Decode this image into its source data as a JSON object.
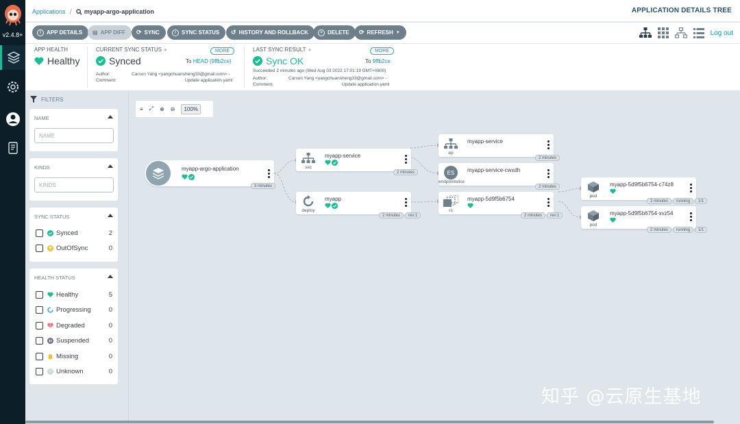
{
  "nav": {
    "version": "v2.4.8+",
    "items": [
      "applications-icon",
      "settings-icon",
      "user-icon",
      "docs-icon"
    ]
  },
  "header": {
    "breadcrumb_root": "Applications",
    "breadcrumb_current": "myapp-argo-application",
    "page_title": "APPLICATION DETAILS TREE"
  },
  "toolbar": {
    "buttons": [
      "APP DETAILS",
      "APP DIFF",
      "SYNC",
      "SYNC STATUS",
      "HISTORY AND ROLLBACK",
      "DELETE",
      "REFRESH"
    ],
    "logout": "Log out"
  },
  "status": {
    "app_health_label": "APP HEALTH",
    "app_health": "Healthy",
    "current_sync_label": "CURRENT SYNC STATUS",
    "current_sync": "Synced",
    "more": "MORE",
    "to_prefix": "To",
    "current_target": "HEAD (9ffb2ce)",
    "author_label": "Author:",
    "comment_label": "Comment:",
    "author": "Carson Yang <yangchuansheng33@gmail.com> -",
    "comment": "Update application.yaml",
    "last_sync_label": "LAST SYNC RESULT",
    "last_sync": "Sync OK",
    "last_target": "9ffb2ce",
    "succeeded": "Succeeded 2 minutes ago (Wed Aug 03 2022 17:01:19 GMT+0800)"
  },
  "filters": {
    "heading": "FILTERS",
    "name_title": "NAME",
    "name_placeholder": "NAME",
    "kinds_title": "KINDS",
    "kinds_placeholder": "KINDS",
    "sync_title": "SYNC STATUS",
    "sync_items": [
      {
        "label": "Synced",
        "count": "2"
      },
      {
        "label": "OutOfSync",
        "count": "0"
      }
    ],
    "health_title": "HEALTH STATUS",
    "health_items": [
      {
        "label": "Healthy",
        "count": "5"
      },
      {
        "label": "Progressing",
        "count": "0"
      },
      {
        "label": "Degraded",
        "count": "0"
      },
      {
        "label": "Suspended",
        "count": "0"
      },
      {
        "label": "Missing",
        "count": "0"
      },
      {
        "label": "Unknown",
        "count": "0"
      }
    ]
  },
  "canvas": {
    "zoom": "100%",
    "app": {
      "name": "myapp-argo-application",
      "age": "3 minutes"
    },
    "nodes": {
      "svc": {
        "name": "myapp-service",
        "kind": "svc",
        "age": "2 minutes"
      },
      "deploy": {
        "name": "myapp",
        "kind": "deploy",
        "age": "2 minutes",
        "rev": "rev:1"
      },
      "ep": {
        "name": "myapp-service",
        "kind": "ep",
        "age": "2 minutes"
      },
      "es": {
        "name": "myapp-service-cwxdh",
        "kind": "endpointslice",
        "age": "2 minutes",
        "badge": "ES"
      },
      "rs": {
        "name": "myapp-5d9f5b6754",
        "kind": "rs",
        "age": "2 minutes",
        "rev": "rev:1"
      },
      "pod1": {
        "name": "myapp-5d9f5b6754-c74z8",
        "kind": "pod",
        "age": "2 minutes",
        "state": "running",
        "ready": "1/1"
      },
      "pod2": {
        "name": "myapp-5d9f5b6754-xvz54",
        "kind": "pod",
        "age": "2 minutes",
        "state": "running",
        "ready": "1/1"
      }
    }
  },
  "watermark": "知乎 @云原生基地",
  "colors": {
    "accent": "#18be94",
    "link": "#0d94b5",
    "nav": "#0c1f29",
    "button": "#6d7f8b"
  }
}
